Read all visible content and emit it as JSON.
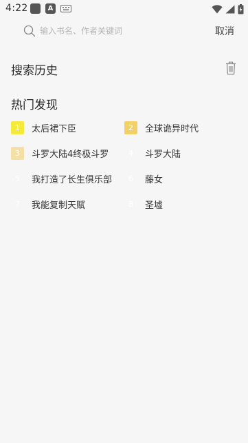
{
  "status_bar": {
    "time": "4:22",
    "app_icon_letter": "A"
  },
  "search": {
    "placeholder": "输入书名、作者关键词",
    "value": "",
    "cancel_label": "取消"
  },
  "history": {
    "title": "搜索历史"
  },
  "hot": {
    "title": "热门发现",
    "items": [
      {
        "rank": "1",
        "title": "太后裙下臣",
        "badge_color": "#f5e93c"
      },
      {
        "rank": "2",
        "title": "全球诡异时代",
        "badge_color": "#f3d065"
      },
      {
        "rank": "3",
        "title": "斗罗大陆4终极斗罗",
        "badge_color": "#f6dea7"
      },
      {
        "rank": "4",
        "title": "斗罗大陆",
        "badge_color": "#f6f6f6"
      },
      {
        "rank": "5",
        "title": "我打造了长生俱乐部",
        "badge_color": "#f6f6f6"
      },
      {
        "rank": "6",
        "title": "藤女",
        "badge_color": "#f6f6f6"
      },
      {
        "rank": "7",
        "title": "我能复制天赋",
        "badge_color": "#f6f6f6"
      },
      {
        "rank": "8",
        "title": "圣墟",
        "badge_color": "#f6f6f6"
      }
    ]
  }
}
